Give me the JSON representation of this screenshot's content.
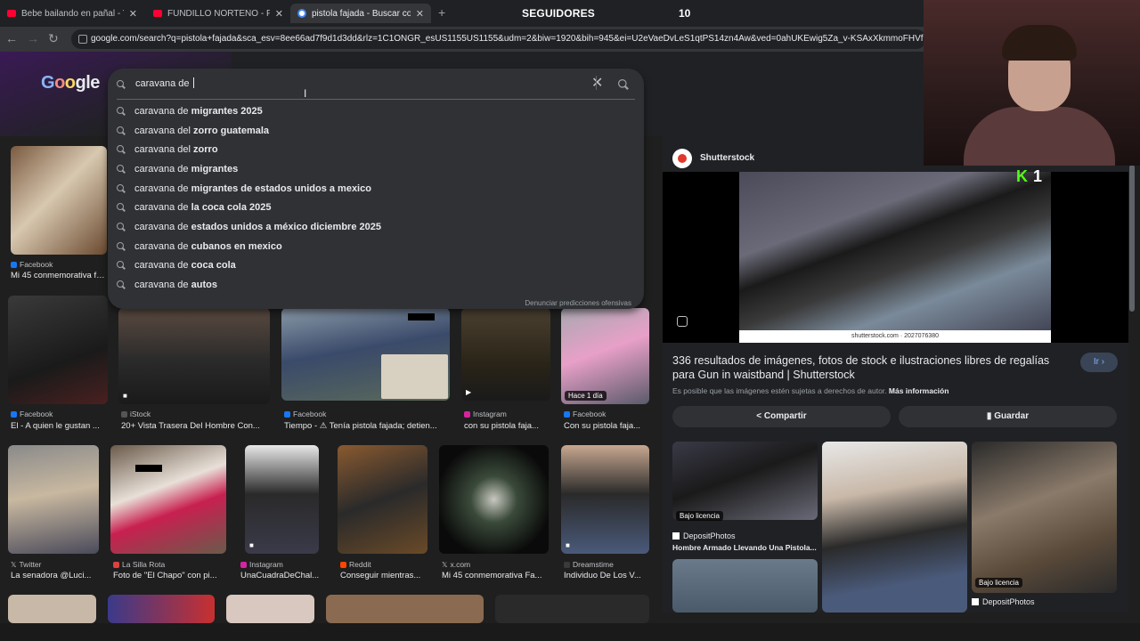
{
  "tabs": [
    {
      "title": "Bebe bailando en pañal - YouTube",
      "favicon": "youtube-icon"
    },
    {
      "title": "FUNDILLO NORTEÑO - FUTA - YouTube",
      "favicon": "youtube-icon"
    },
    {
      "title": "pistola fajada - Buscar con Google",
      "favicon": "google-icon",
      "active": true
    }
  ],
  "overlay": {
    "followers_label": "SEGUIDORES",
    "followers_count": "10",
    "kick_count": "1"
  },
  "url": "google.com/search?q=pistola+fajada&sca_esv=8ee66ad7f9d1d3dd&rlz=1C1ONGR_esUS1155US1155&udm=2&biw=1920&bih=945&ei=U2eVaeDvLeS1qtPS14zn4Aw&ved=0ahUKEwig5Za_v-KSAxXkmmoFHVfGGcwQ4dUDC",
  "search": {
    "value": "caravana de ",
    "report_text": "Denunciar predicciones ofensivas",
    "suggestions": [
      {
        "prefix": "caravana de ",
        "bold": "migrantes 2025"
      },
      {
        "prefix": "caravana del ",
        "bold": "zorro guatemala"
      },
      {
        "prefix": "caravana del ",
        "bold": "zorro"
      },
      {
        "prefix": "caravana de ",
        "bold": "migrantes"
      },
      {
        "prefix": "caravana de ",
        "bold": "migrantes de estados unidos a mexico"
      },
      {
        "prefix": "caravana de ",
        "bold": "la coca cola 2025"
      },
      {
        "prefix": "caravana de ",
        "bold": "estados unidos a méxico diciembre 2025"
      },
      {
        "prefix": "caravana de ",
        "bold": "cubanos en mexico"
      },
      {
        "prefix": "caravana de ",
        "bold": "coca cola"
      },
      {
        "prefix": "caravana de ",
        "bold": "autos"
      }
    ]
  },
  "results": {
    "row0": [
      {
        "source": "Facebook",
        "caption": "Mi 45 conmemorativa faj..."
      }
    ],
    "row1": [
      {
        "source": "Facebook",
        "caption": "El - A quien le gustan ..."
      },
      {
        "source": "iStock",
        "caption": "20+ Vista Trasera Del Hombre Con..."
      },
      {
        "source": "Facebook",
        "caption": "Tiempo - ⚠ Tenía pistola fajada; detien..."
      },
      {
        "source": "Instagram",
        "caption": "con su pistola faja..."
      },
      {
        "source": "Facebook",
        "caption": "Con su pistola faja...",
        "badge": "Hace 1 día"
      }
    ],
    "row2": [
      {
        "source": "Twitter",
        "caption": "La senadora @Luci..."
      },
      {
        "source": "La Silla Rota",
        "caption": "Foto de \"El Chapo\" con pi..."
      },
      {
        "source": "Instagram",
        "caption": "UnaCuadraDeChal..."
      },
      {
        "source": "Reddit",
        "caption": "Conseguir mientras..."
      },
      {
        "source": "x.com",
        "caption": "Mi 45 conmemorativa Fa..."
      },
      {
        "source": "Dreamstime",
        "caption": "Individuo De Los V..."
      }
    ]
  },
  "panel": {
    "site": "Shutterstock",
    "watermark": "shutterstock.com · 2027076380",
    "title": "336 resultados de imágenes, fotos de stock e ilustraciones libres de regalías para Gun in waistband | Shutterstock",
    "go_label": "Ir ›",
    "note": "Es posible que las imágenes estén sujetas a derechos de autor.",
    "more_info": "Más información",
    "share_label": "Compartir",
    "save_label": "Guardar",
    "related": [
      {
        "license": "Bajo licencia",
        "source": "DepositPhotos",
        "caption": "Hombre Armado Llevando Una Pistola..."
      },
      {
        "license": "Bajo licencia",
        "source": "DepositPhotos",
        "caption": ""
      }
    ]
  },
  "colors": {
    "bg": "#1f1f1f",
    "panel": "#303134",
    "accent": "#8ab4f8"
  }
}
